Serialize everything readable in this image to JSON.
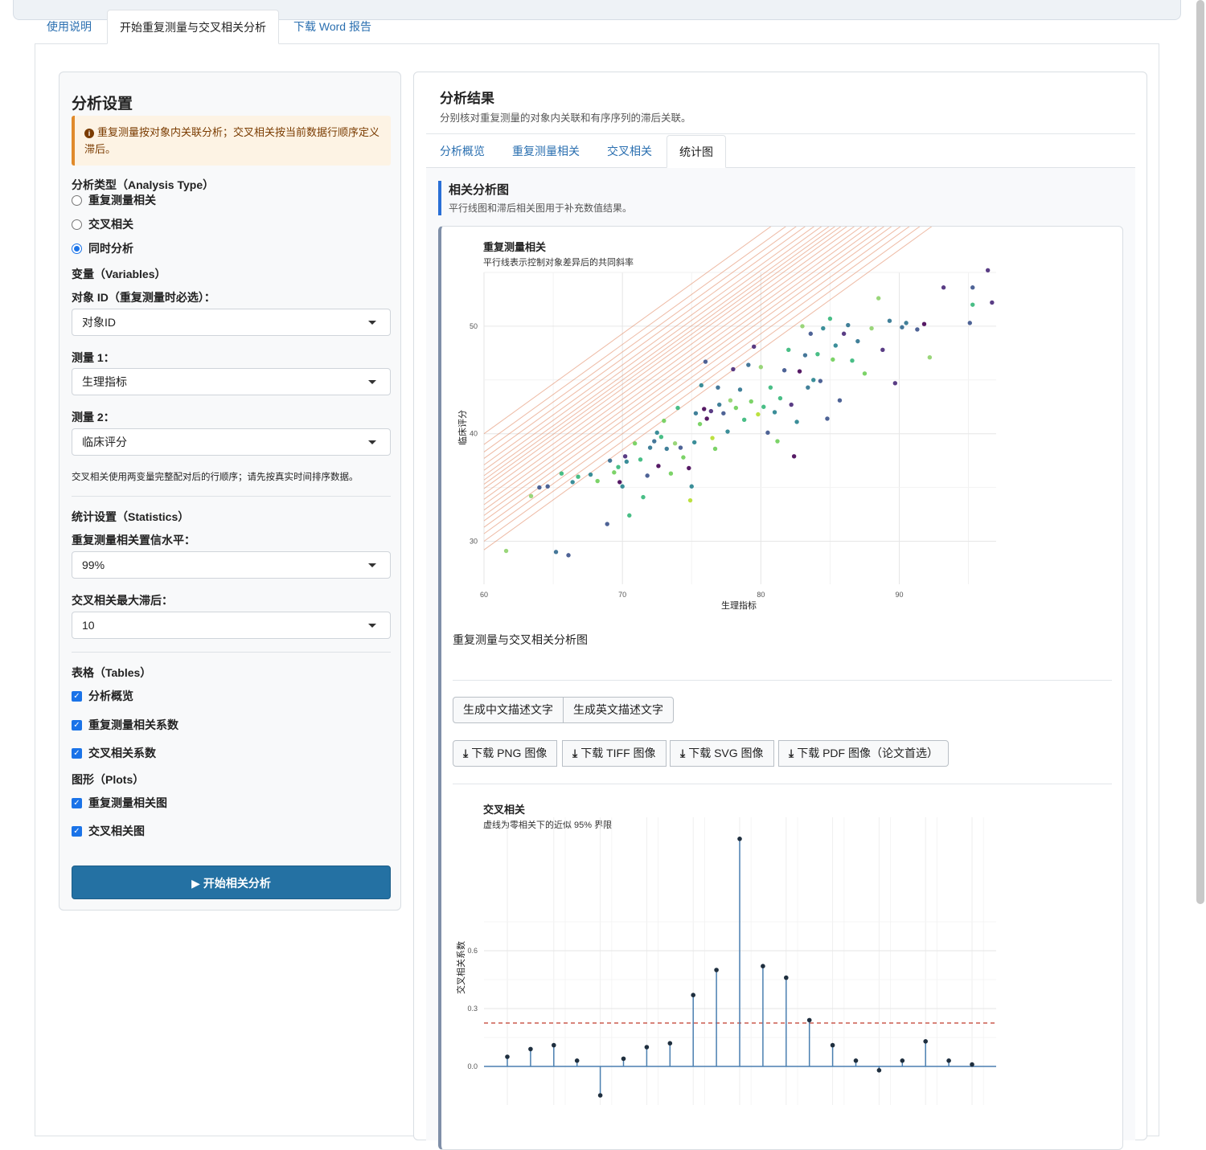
{
  "main_tabs": [
    "使用说明",
    "开始重复测量与交叉相关分析",
    "下载 Word 报告"
  ],
  "sidebar": {
    "title": "分析设置",
    "alert": "重复测量按对象内关联分析；交叉相关按当前数据行顺序定义滞后。",
    "analysis_type_label": "分析类型（Analysis Type）",
    "analysis_types": [
      "重复测量相关",
      "交叉相关",
      "同时分析"
    ],
    "analysis_type_selected": "同时分析",
    "variables_label": "变量（Variables）",
    "subject_id_label": "对象 ID（重复测量时必选）：",
    "subject_id_value": "对象ID",
    "measure1_label": "测量 1：",
    "measure1_value": "生理指标",
    "measure2_label": "测量 2：",
    "measure2_value": "临床评分",
    "help_text": "交叉相关使用两变量完整配对后的行顺序；请先按真实时间排序数据。",
    "stats_label": "统计设置（Statistics）",
    "ci_label": "重复测量相关置信水平：",
    "ci_value": "99%",
    "maxlag_label": "交叉相关最大滞后：",
    "maxlag_value": "10",
    "tables_label": "表格（Tables）",
    "tables": [
      "分析概览",
      "重复测量相关系数",
      "交叉相关系数"
    ],
    "plots_label": "图形（Plots）",
    "plots": [
      "重复测量相关图",
      "交叉相关图"
    ],
    "run_button": "开始相关分析"
  },
  "results": {
    "title": "分析结果",
    "subtitle": "分别核对重复测量的对象内关联和有序序列的滞后关联。",
    "tabs": [
      "分析概览",
      "重复测量相关",
      "交叉相关",
      "统计图"
    ],
    "active_tab": "统计图",
    "section_title": "相关分析图",
    "section_subtitle": "平行线图和滞后相关图用于补充数值结果。",
    "caption": "重复测量与交叉相关分析图",
    "text_buttons": [
      "生成中文描述文字",
      "生成英文描述文字"
    ],
    "download_buttons": [
      "下载 PNG 图像",
      "下载 TIFF 图像",
      "下载 SVG 图像",
      "下载 PDF 图像（论文首选）"
    ]
  },
  "chart_data": [
    {
      "type": "scatter",
      "title": "重复测量相关",
      "subtitle": "平行线表示控制对象差异后的共同斜率",
      "xlabel": "生理指标",
      "ylabel": "临床评分",
      "xlim": [
        60,
        97
      ],
      "ylim": [
        26,
        55
      ],
      "xticks": [
        60,
        70,
        80,
        90
      ],
      "yticks": [
        30,
        40,
        50
      ],
      "common_slope": 0.93,
      "parallel_line_intercepts_at_x60": [
        29.2,
        30.0,
        30.7,
        31.3,
        31.9,
        32.4,
        32.9,
        33.4,
        33.9,
        34.4,
        34.9,
        35.3,
        35.7,
        36.1,
        36.6,
        37.1,
        37.7,
        38.3,
        39.0,
        40.0
      ],
      "points": [
        [
          61.6,
          29.1,
          "#8fd16b"
        ],
        [
          63.4,
          34.2,
          "#8fd16b"
        ],
        [
          64.0,
          35.0,
          "#3b528b"
        ],
        [
          64.6,
          35.1,
          "#3b528b"
        ],
        [
          65.2,
          29.0,
          "#31688e"
        ],
        [
          65.6,
          36.3,
          "#35b779"
        ],
        [
          66.1,
          28.7,
          "#3b528b"
        ],
        [
          66.4,
          35.5,
          "#26828e"
        ],
        [
          66.8,
          36.0,
          "#35b779"
        ],
        [
          67.7,
          36.2,
          "#26828e"
        ],
        [
          68.2,
          35.6,
          "#6ece58"
        ],
        [
          68.9,
          31.6,
          "#3b528b"
        ],
        [
          69.1,
          37.5,
          "#31688e"
        ],
        [
          69.4,
          36.4,
          "#6ece58"
        ],
        [
          69.7,
          36.9,
          "#35b779"
        ],
        [
          69.8,
          35.5,
          "#440154"
        ],
        [
          70.0,
          35.1,
          "#26828e"
        ],
        [
          70.2,
          37.9,
          "#482878"
        ],
        [
          70.3,
          37.4,
          "#26828e"
        ],
        [
          70.5,
          32.4,
          "#35b779"
        ],
        [
          70.9,
          39.1,
          "#6ece58"
        ],
        [
          71.3,
          37.6,
          "#35b779"
        ],
        [
          71.5,
          34.1,
          "#35b779"
        ],
        [
          71.8,
          36.1,
          "#3b528b"
        ],
        [
          72.0,
          38.7,
          "#2c728e"
        ],
        [
          72.3,
          39.3,
          "#31688e"
        ],
        [
          72.5,
          40.1,
          "#26828e"
        ],
        [
          72.6,
          37.0,
          "#440154"
        ],
        [
          72.8,
          39.7,
          "#35b779"
        ],
        [
          73.0,
          41.2,
          "#6ece58"
        ],
        [
          73.2,
          38.6,
          "#2c728e"
        ],
        [
          73.5,
          36.3,
          "#6ece58"
        ],
        [
          73.8,
          39.1,
          "#8fd16b"
        ],
        [
          74.0,
          42.4,
          "#35b779"
        ],
        [
          74.2,
          38.7,
          "#3b528b"
        ],
        [
          74.4,
          37.8,
          "#6ece58"
        ],
        [
          74.8,
          36.8,
          "#440154"
        ],
        [
          74.9,
          33.8,
          "#b5de2b"
        ],
        [
          75.0,
          35.1,
          "#26828e"
        ],
        [
          75.2,
          39.2,
          "#26828e"
        ],
        [
          75.3,
          41.9,
          "#2c728e"
        ],
        [
          75.6,
          40.9,
          "#6ece58"
        ],
        [
          75.7,
          44.5,
          "#26828e"
        ],
        [
          75.9,
          42.3,
          "#440154"
        ],
        [
          76.0,
          46.7,
          "#3b528b"
        ],
        [
          76.1,
          41.4,
          "#440154"
        ],
        [
          76.4,
          42.1,
          "#482878"
        ],
        [
          76.5,
          39.6,
          "#b5de2b"
        ],
        [
          76.7,
          38.6,
          "#6ece58"
        ],
        [
          76.9,
          44.3,
          "#31688e"
        ],
        [
          77.0,
          42.7,
          "#2c728e"
        ],
        [
          77.3,
          41.9,
          "#3b528b"
        ],
        [
          77.6,
          40.2,
          "#26828e"
        ],
        [
          77.8,
          43.1,
          "#8fd16b"
        ],
        [
          78.0,
          46.0,
          "#482878"
        ],
        [
          78.2,
          42.4,
          "#6ece58"
        ],
        [
          78.5,
          44.1,
          "#2c728e"
        ],
        [
          78.8,
          41.3,
          "#35b779"
        ],
        [
          79.1,
          46.4,
          "#31688e"
        ],
        [
          79.3,
          43.0,
          "#6ece58"
        ],
        [
          79.5,
          48.1,
          "#482878"
        ],
        [
          79.8,
          41.8,
          "#b5de2b"
        ],
        [
          80.0,
          46.2,
          "#8fd16b"
        ],
        [
          80.2,
          42.5,
          "#35b779"
        ],
        [
          80.5,
          40.1,
          "#3b528b"
        ],
        [
          80.7,
          44.3,
          "#35b779"
        ],
        [
          81.0,
          42.0,
          "#26828e"
        ],
        [
          81.2,
          39.3,
          "#6ece58"
        ],
        [
          81.4,
          43.3,
          "#35b779"
        ],
        [
          81.7,
          45.9,
          "#3b528b"
        ],
        [
          82.0,
          47.8,
          "#35b779"
        ],
        [
          82.2,
          42.7,
          "#482878"
        ],
        [
          82.4,
          37.9,
          "#440154"
        ],
        [
          82.6,
          41.1,
          "#26828e"
        ],
        [
          82.8,
          45.8,
          "#440154"
        ],
        [
          83.0,
          50.0,
          "#8fd16b"
        ],
        [
          83.2,
          47.3,
          "#31688e"
        ],
        [
          83.4,
          44.3,
          "#2c728e"
        ],
        [
          83.6,
          49.3,
          "#3b528b"
        ],
        [
          83.8,
          45.0,
          "#26828e"
        ],
        [
          84.1,
          47.4,
          "#35b779"
        ],
        [
          84.3,
          44.9,
          "#3b528b"
        ],
        [
          84.5,
          49.8,
          "#26828e"
        ],
        [
          84.8,
          41.4,
          "#3b528b"
        ],
        [
          85.0,
          50.7,
          "#35b779"
        ],
        [
          85.2,
          46.9,
          "#6ece58"
        ],
        [
          85.4,
          48.2,
          "#26828e"
        ],
        [
          85.7,
          43.1,
          "#3b528b"
        ],
        [
          86.0,
          49.3,
          "#482878"
        ],
        [
          86.3,
          50.1,
          "#2c728e"
        ],
        [
          86.6,
          46.8,
          "#35b779"
        ],
        [
          87.0,
          48.6,
          "#2c728e"
        ],
        [
          87.5,
          45.6,
          "#6ece58"
        ],
        [
          88.0,
          49.8,
          "#8fd16b"
        ],
        [
          88.5,
          52.6,
          "#8fd16b"
        ],
        [
          88.8,
          47.8,
          "#482878"
        ],
        [
          89.3,
          50.5,
          "#2c728e"
        ],
        [
          89.7,
          44.7,
          "#482878"
        ],
        [
          90.2,
          49.9,
          "#31688e"
        ],
        [
          90.5,
          50.3,
          "#2c728e"
        ],
        [
          91.3,
          49.7,
          "#3b528b"
        ],
        [
          91.8,
          50.2,
          "#440154"
        ],
        [
          92.2,
          47.1,
          "#8fd16b"
        ],
        [
          93.2,
          53.6,
          "#482878"
        ],
        [
          95.1,
          50.3,
          "#3b528b"
        ],
        [
          95.3,
          52.0,
          "#35b779"
        ],
        [
          95.3,
          53.6,
          "#3b528b"
        ],
        [
          96.4,
          55.2,
          "#482878"
        ],
        [
          96.7,
          52.2,
          "#482878"
        ]
      ]
    },
    {
      "type": "bar",
      "title": "交叉相关",
      "subtitle": "虚线为零相关下的近似 95% 界限",
      "xlabel": "",
      "ylabel": "交叉相关系数",
      "x": [
        -10,
        -9,
        -8,
        -7,
        -6,
        -5,
        -4,
        -3,
        -2,
        -1,
        0,
        1,
        2,
        3,
        4,
        5,
        6,
        7,
        8,
        9,
        10
      ],
      "values": [
        0.05,
        0.09,
        0.11,
        0.03,
        -0.15,
        0.04,
        0.1,
        0.12,
        0.37,
        0.5,
        1.18,
        0.52,
        0.46,
        0.24,
        0.11,
        0.03,
        -0.02,
        0.03,
        0.13,
        0.03,
        0.01
      ],
      "ylim": [
        -0.2,
        1.25
      ],
      "yticks": [
        0.0,
        0.3,
        0.6
      ],
      "confidence_bound": 0.225
    }
  ]
}
